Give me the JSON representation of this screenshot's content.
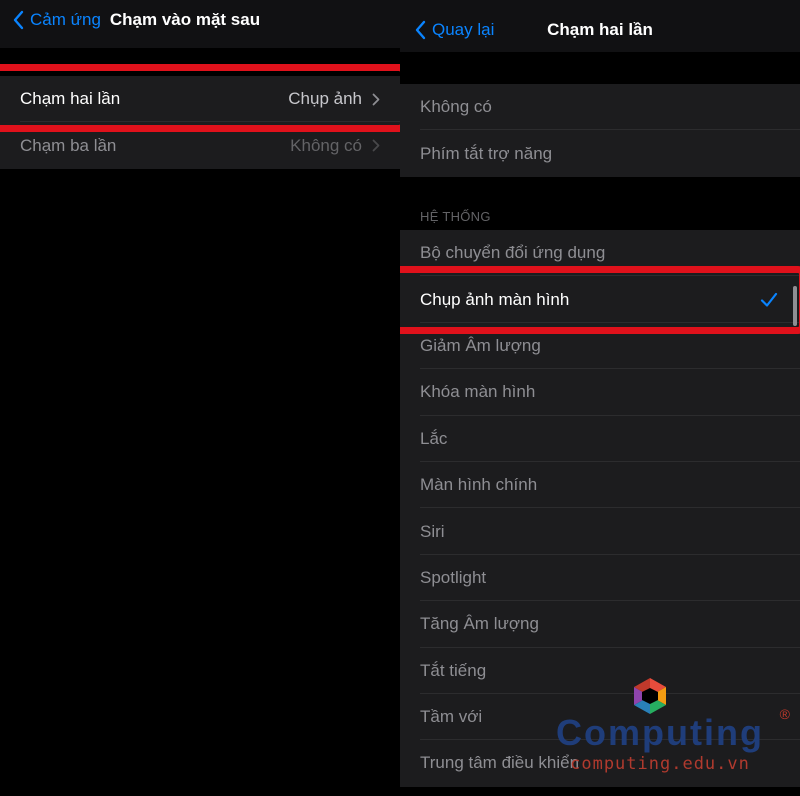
{
  "left_screen": {
    "back_label": "Cảm ứng",
    "title": "Chạm vào mặt sau",
    "rows": [
      {
        "label": "Chạm hai lần",
        "value": "Chụp ảnh"
      },
      {
        "label": "Chạm ba lần",
        "value": "Không có"
      }
    ]
  },
  "right_screen": {
    "back_label": "Quay lại",
    "title": "Chạm hai lần",
    "top_items": [
      {
        "label": "Không có"
      },
      {
        "label": "Phím tắt trợ năng"
      }
    ],
    "section_header": "HỆ THỐNG",
    "system_items": [
      {
        "label": "Bộ chuyển đổi ứng dụng"
      },
      {
        "label": "Chụp ảnh màn hình",
        "selected": true
      },
      {
        "label": "Giảm Âm lượng"
      },
      {
        "label": "Khóa màn hình"
      },
      {
        "label": "Lắc"
      },
      {
        "label": "Màn hình chính"
      },
      {
        "label": "Siri"
      },
      {
        "label": "Spotlight"
      },
      {
        "label": "Tăng Âm lượng"
      },
      {
        "label": "Tắt tiếng"
      },
      {
        "label": "Tầm với"
      },
      {
        "label": "Trung tâm điều khiển"
      }
    ]
  },
  "watermark": {
    "brand": "Computing",
    "url": "computing.edu.vn",
    "reg_mark": "®"
  },
  "colors": {
    "accent": "#0a84ff",
    "highlight": "#e0111b",
    "cell_background": "#1c1c1e"
  },
  "icons": [
    "chevron-left-icon",
    "chevron-right-icon",
    "checkmark-icon",
    "computing-logo-icon"
  ]
}
